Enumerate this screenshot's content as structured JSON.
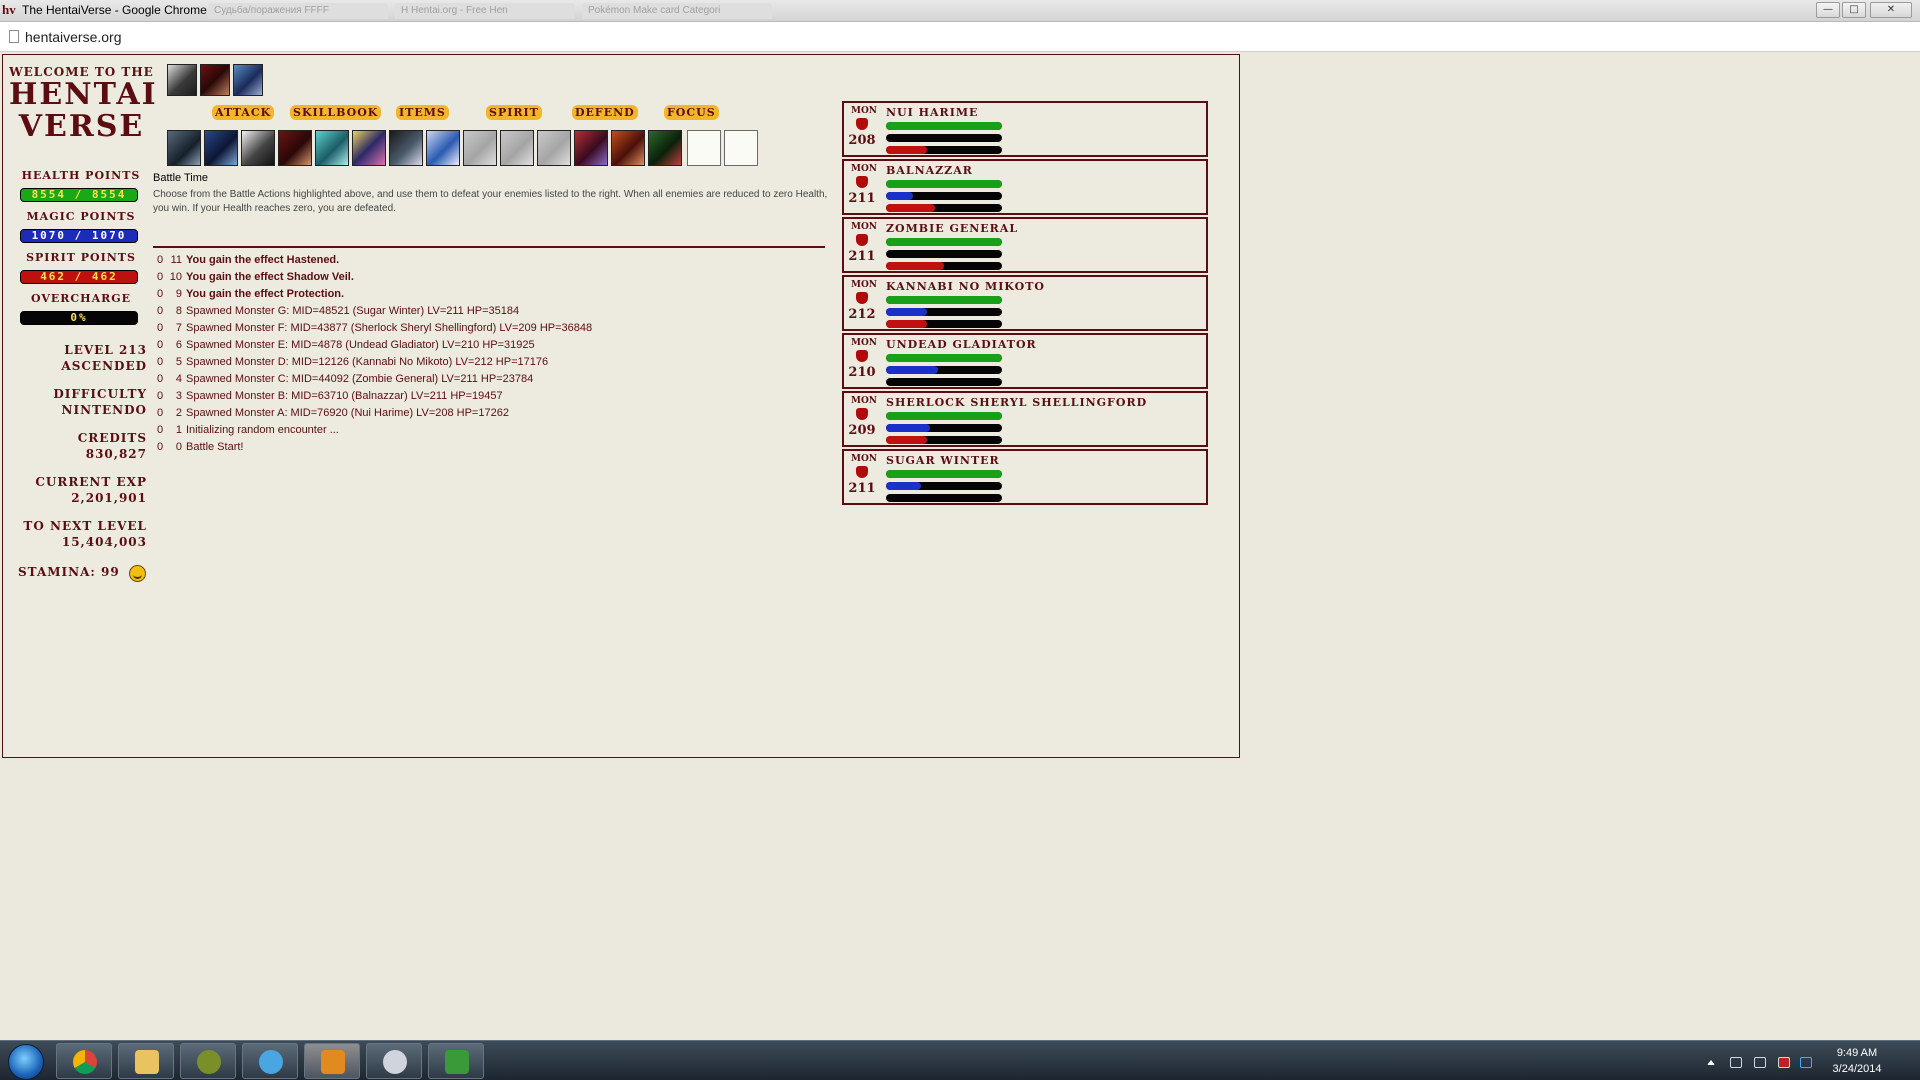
{
  "window": {
    "title": "The HentaiVerse - Google Chrome",
    "favicon_text": "hv",
    "tabs": [
      "Судьба/поражения FFFF",
      "Н Hentai.org - Free Hen",
      "Pokémon Make card Categori"
    ],
    "controls": {
      "minimize": "—",
      "maximize": "□",
      "close": "✕"
    }
  },
  "browser": {
    "url": "hentaiverse.org"
  },
  "sidebar": {
    "welcome": "WELCOME TO THE",
    "logo_line1": "HENTAI",
    "logo_line2": "VERSE",
    "health_label": "HEALTH POINTS",
    "health_value": "8554 / 8554",
    "magic_label": "MAGIC POINTS",
    "magic_value": "1070 / 1070",
    "spirit_label": "SPIRIT POINTS",
    "spirit_value": "462 / 462",
    "overcharge_label": "OVERCHARGE",
    "overcharge_value": "0%",
    "level_line1": "LEVEL 213",
    "level_line2": "ASCENDED",
    "difficulty_label": "DIFFICULTY",
    "difficulty_value": "NINTENDO",
    "credits_label": "CREDITS",
    "credits_value": "830,827",
    "exp_label": "CURRENT EXP",
    "exp_value": "2,201,901",
    "next_label": "TO NEXT LEVEL",
    "next_value": "15,404,003",
    "stamina": "STAMINA: 99"
  },
  "actions": {
    "menu": [
      "ATTACK",
      "SKILLBOOK",
      "ITEMS",
      "SPIRIT",
      "DEFEND",
      "FOCUS"
    ],
    "effects": [
      "Hastened",
      "Shadow Veil",
      "Protection"
    ]
  },
  "battle": {
    "title": "Battle Time",
    "description": "Choose from the Battle Actions highlighted above, and use them to defeat your enemies listed to the right. When all enemies are reduced to zero Health, you win. If your Health reaches zero, you are defeated.",
    "log": [
      {
        "t": "0",
        "a": "11",
        "msg": "You gain the effect Hastened.",
        "bold": true
      },
      {
        "t": "0",
        "a": "10",
        "msg": "You gain the effect Shadow Veil.",
        "bold": true
      },
      {
        "t": "0",
        "a": "9",
        "msg": "You gain the effect Protection.",
        "bold": true
      },
      {
        "t": "0",
        "a": "8",
        "msg": "Spawned Monster G: MID=48521 (Sugar Winter) LV=211 HP=35184",
        "bold": false
      },
      {
        "t": "0",
        "a": "7",
        "msg": "Spawned Monster F: MID=43877 (Sherlock Sheryl Shellingford) LV=209 HP=36848",
        "bold": false
      },
      {
        "t": "0",
        "a": "6",
        "msg": "Spawned Monster E: MID=4878 (Undead Gladiator) LV=210 HP=31925",
        "bold": false
      },
      {
        "t": "0",
        "a": "5",
        "msg": "Spawned Monster D: MID=12126 (Kannabi No Mikoto) LV=212 HP=17176",
        "bold": false
      },
      {
        "t": "0",
        "a": "4",
        "msg": "Spawned Monster C: MID=44092 (Zombie General) LV=211 HP=23784",
        "bold": false
      },
      {
        "t": "0",
        "a": "3",
        "msg": "Spawned Monster B: MID=63710 (Balnazzar) LV=211 HP=19457",
        "bold": false
      },
      {
        "t": "0",
        "a": "2",
        "msg": "Spawned Monster A: MID=76920 (Nui Harime) LV=208 HP=17262",
        "bold": false
      },
      {
        "t": "0",
        "a": "1",
        "msg": "Initializing random encounter ...",
        "bold": false
      },
      {
        "t": "0",
        "a": "0",
        "msg": "Battle Start!",
        "bold": false
      }
    ]
  },
  "monsters": [
    {
      "tag": "MON",
      "name": "NUI HARIME",
      "level": "208",
      "hp": 1.0,
      "mp": 0.0,
      "sp": 0.35
    },
    {
      "tag": "MON",
      "name": "BALNAZZAR",
      "level": "211",
      "hp": 1.0,
      "mp": 0.23,
      "sp": 0.42
    },
    {
      "tag": "MON",
      "name": "ZOMBIE GENERAL",
      "level": "211",
      "hp": 1.0,
      "mp": 0.0,
      "sp": 0.5
    },
    {
      "tag": "MON",
      "name": "KANNABI NO MIKOTO",
      "level": "212",
      "hp": 1.0,
      "mp": 0.35,
      "sp": 0.35
    },
    {
      "tag": "MON",
      "name": "UNDEAD GLADIATOR",
      "level": "210",
      "hp": 1.0,
      "mp": 0.45,
      "sp": 0.0
    },
    {
      "tag": "MON",
      "name": "SHERLOCK SHERYL SHELLINGFORD",
      "level": "209",
      "hp": 1.0,
      "mp": 0.38,
      "sp": 0.35
    },
    {
      "tag": "MON",
      "name": "SUGAR WINTER",
      "level": "211",
      "hp": 1.0,
      "mp": 0.3,
      "sp": 0.0
    }
  ],
  "taskbar": {
    "apps": [
      "chrome-icon",
      "explorer-icon",
      "mail-icon",
      "messenger-icon",
      "media-icon",
      "paint-icon",
      "notes-icon"
    ],
    "time": "9:49 AM",
    "date": "3/24/2014"
  },
  "colors": {
    "accent": "#5c0d12",
    "menu_bg": "#f3b52b",
    "hp": "#18a818",
    "mp": "#1c2bb8",
    "sp": "#bf1010"
  }
}
